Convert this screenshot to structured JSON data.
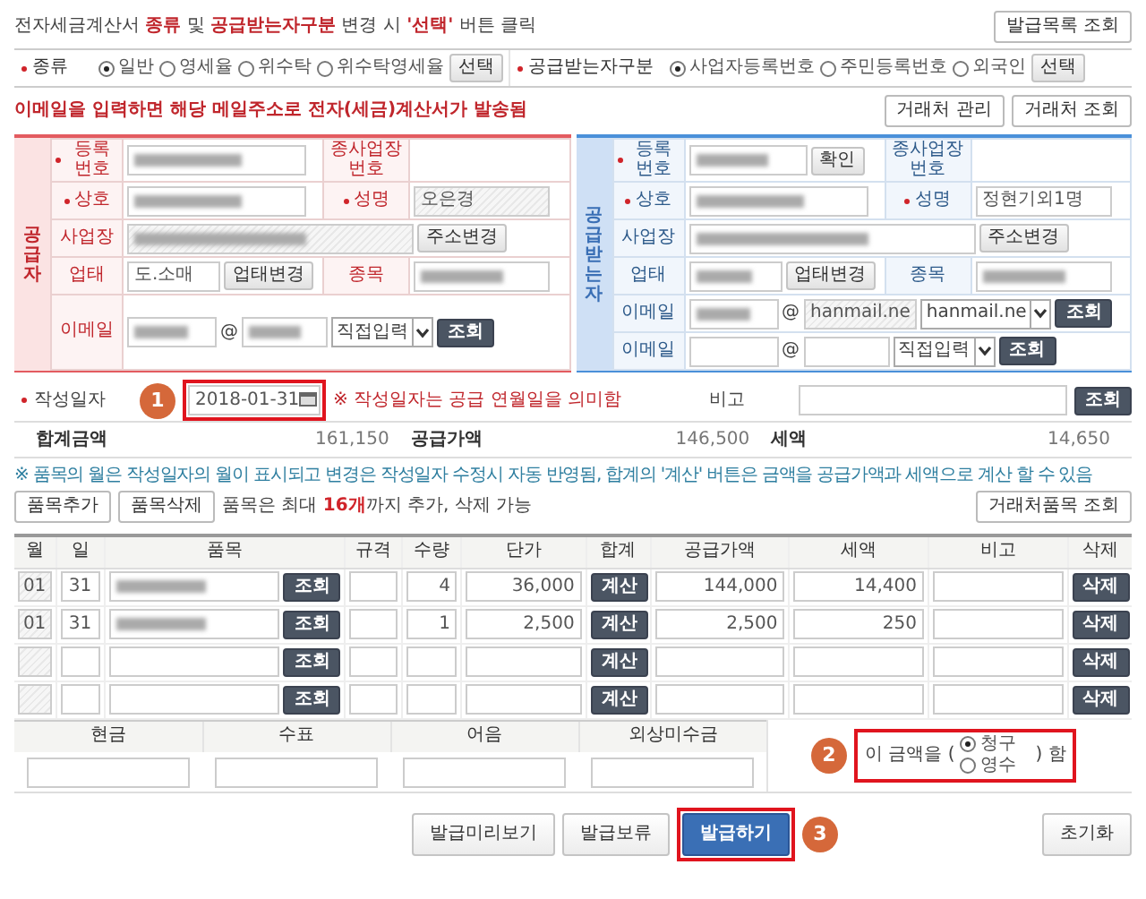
{
  "notice": "전자세금계산서 **종류** 및 **공급받는자구분** 변경 시 **'선택'** 버튼 클릭",
  "list_button": "발급목록 조회",
  "type_groups": [
    {
      "label": "종류",
      "required": true,
      "options": [
        {
          "label": "일반",
          "selected": true
        },
        {
          "label": "영세율",
          "selected": false
        },
        {
          "label": "위수탁",
          "selected": false
        },
        {
          "label": "위수탁영세율",
          "selected": false
        }
      ],
      "button": "선택"
    },
    {
      "label": "공급받는자구분",
      "required": true,
      "options": [
        {
          "label": "사업자등록번호",
          "selected": true
        },
        {
          "label": "주민등록번호",
          "selected": false
        },
        {
          "label": "외국인",
          "selected": false
        }
      ],
      "button": "선택"
    }
  ],
  "email_notice": "이메일을 입력하면 해당 메일주소로 전자(세금)계산서가 발송됨",
  "partner_buttons": [
    "거래처 관리",
    "거래처 조회"
  ],
  "parties": [
    {
      "kind": "supplier",
      "side_label": "공급자",
      "reg_no": {
        "label": "등록 번호",
        "required": true,
        "blurred": true
      },
      "branch_no": {
        "label": "종사업장 번호"
      },
      "company": {
        "label": "상호",
        "required": true,
        "blurred": true
      },
      "ceo": {
        "label": "성명",
        "required": true,
        "value": "오은경",
        "readonly": true
      },
      "address": {
        "label": "사업장",
        "blurred": true,
        "readonly": true,
        "button": "주소변경"
      },
      "business_type": {
        "label": "업태",
        "value": "도.소매",
        "button": "업태변경"
      },
      "business_item": {
        "label": "종목",
        "blurred": true
      },
      "emails": [
        {
          "label": "이메일",
          "user_blurred": true,
          "at": "@",
          "domain": {
            "blurred": true
          },
          "select": "직접입력",
          "button": "조회"
        }
      ]
    },
    {
      "kind": "receiver",
      "side_label": "공급받는자",
      "reg_no": {
        "label": "등록 번호",
        "required": true,
        "blurred": true,
        "button": "확인"
      },
      "branch_no": {
        "label": "종사업장 번호"
      },
      "company": {
        "label": "상호",
        "required": true,
        "blurred": true
      },
      "ceo": {
        "label": "성명",
        "required": true,
        "value": "정현기외1명"
      },
      "address": {
        "label": "사업장",
        "blurred": true,
        "button": "주소변경"
      },
      "business_type": {
        "label": "업태",
        "blurred": true,
        "button": "업태변경"
      },
      "business_item": {
        "label": "종목",
        "blurred": true
      },
      "emails": [
        {
          "label": "이메일",
          "user_blurred": true,
          "at": "@",
          "domain": {
            "value": "hanmail.ne",
            "readonly": true
          },
          "select": "hanmail.ne",
          "button": "조회"
        },
        {
          "label": "이메일",
          "at": "@",
          "select": "직접입력",
          "button": "조회"
        }
      ]
    }
  ],
  "date_row": {
    "label": "작성일자",
    "required": true,
    "callout": "1",
    "highlighted": true,
    "value": "2018-01-31",
    "note": "※ 작성일자는 공급 연월일을 의미함",
    "memo_label": "비고",
    "memo_button": "조회"
  },
  "totals": [
    {
      "label": "합계금액",
      "value": "161,150"
    },
    {
      "label": "공급가액",
      "value": "146,500"
    },
    {
      "label": "세액",
      "value": "14,650"
    }
  ],
  "items_note": "※ 품목의 월은 작성일자의 월이 표시되고 변경은 작성일자 수정시 자동 반영됨, 합계의 '계산' 버튼은 금액을 공급가액과 세액으로 계산 할 수 있음",
  "item_buttons": [
    "품목추가",
    "품목삭제"
  ],
  "item_limit_note": "품목은 최대 **16개**까지 추가, 삭제 가능",
  "partner_items_button": "거래처품목 조회",
  "item_columns": [
    "월",
    "일",
    "품목",
    "규격",
    "수량",
    "단가",
    "합계",
    "공급가액",
    "세액",
    "비고",
    "삭제"
  ],
  "item_rows": [
    {
      "month": "01",
      "day": "31",
      "item_blurred": true,
      "lookup": "조회",
      "qty": "4",
      "unit_price": "36,000",
      "calc": "계산",
      "supply": "144,000",
      "tax": "14,400",
      "delete": "삭제"
    },
    {
      "month": "01",
      "day": "31",
      "item_blurred": true,
      "lookup": "조회",
      "qty": "1",
      "unit_price": "2,500",
      "calc": "계산",
      "supply": "2,500",
      "tax": "250",
      "delete": "삭제"
    },
    {
      "lookup": "조회",
      "calc": "계산",
      "delete": "삭제"
    },
    {
      "lookup": "조회",
      "calc": "계산",
      "delete": "삭제"
    }
  ],
  "payment_columns": [
    "현금",
    "수표",
    "어음",
    "외상미수금"
  ],
  "claim": {
    "callout": "2",
    "highlighted": true,
    "prefix": "이 금액을 (",
    "options": [
      {
        "label": "청구",
        "selected": true
      },
      {
        "label": "영수",
        "selected": false
      }
    ],
    "suffix": ") 함"
  },
  "actions": [
    {
      "label": "발급미리보기",
      "kind": "default",
      "highlighted": false
    },
    {
      "label": "발급보류",
      "kind": "default",
      "highlighted": false
    },
    {
      "label": "발급하기",
      "kind": "primary",
      "highlighted": true,
      "callout": "3"
    }
  ],
  "reset_button": "초기화"
}
